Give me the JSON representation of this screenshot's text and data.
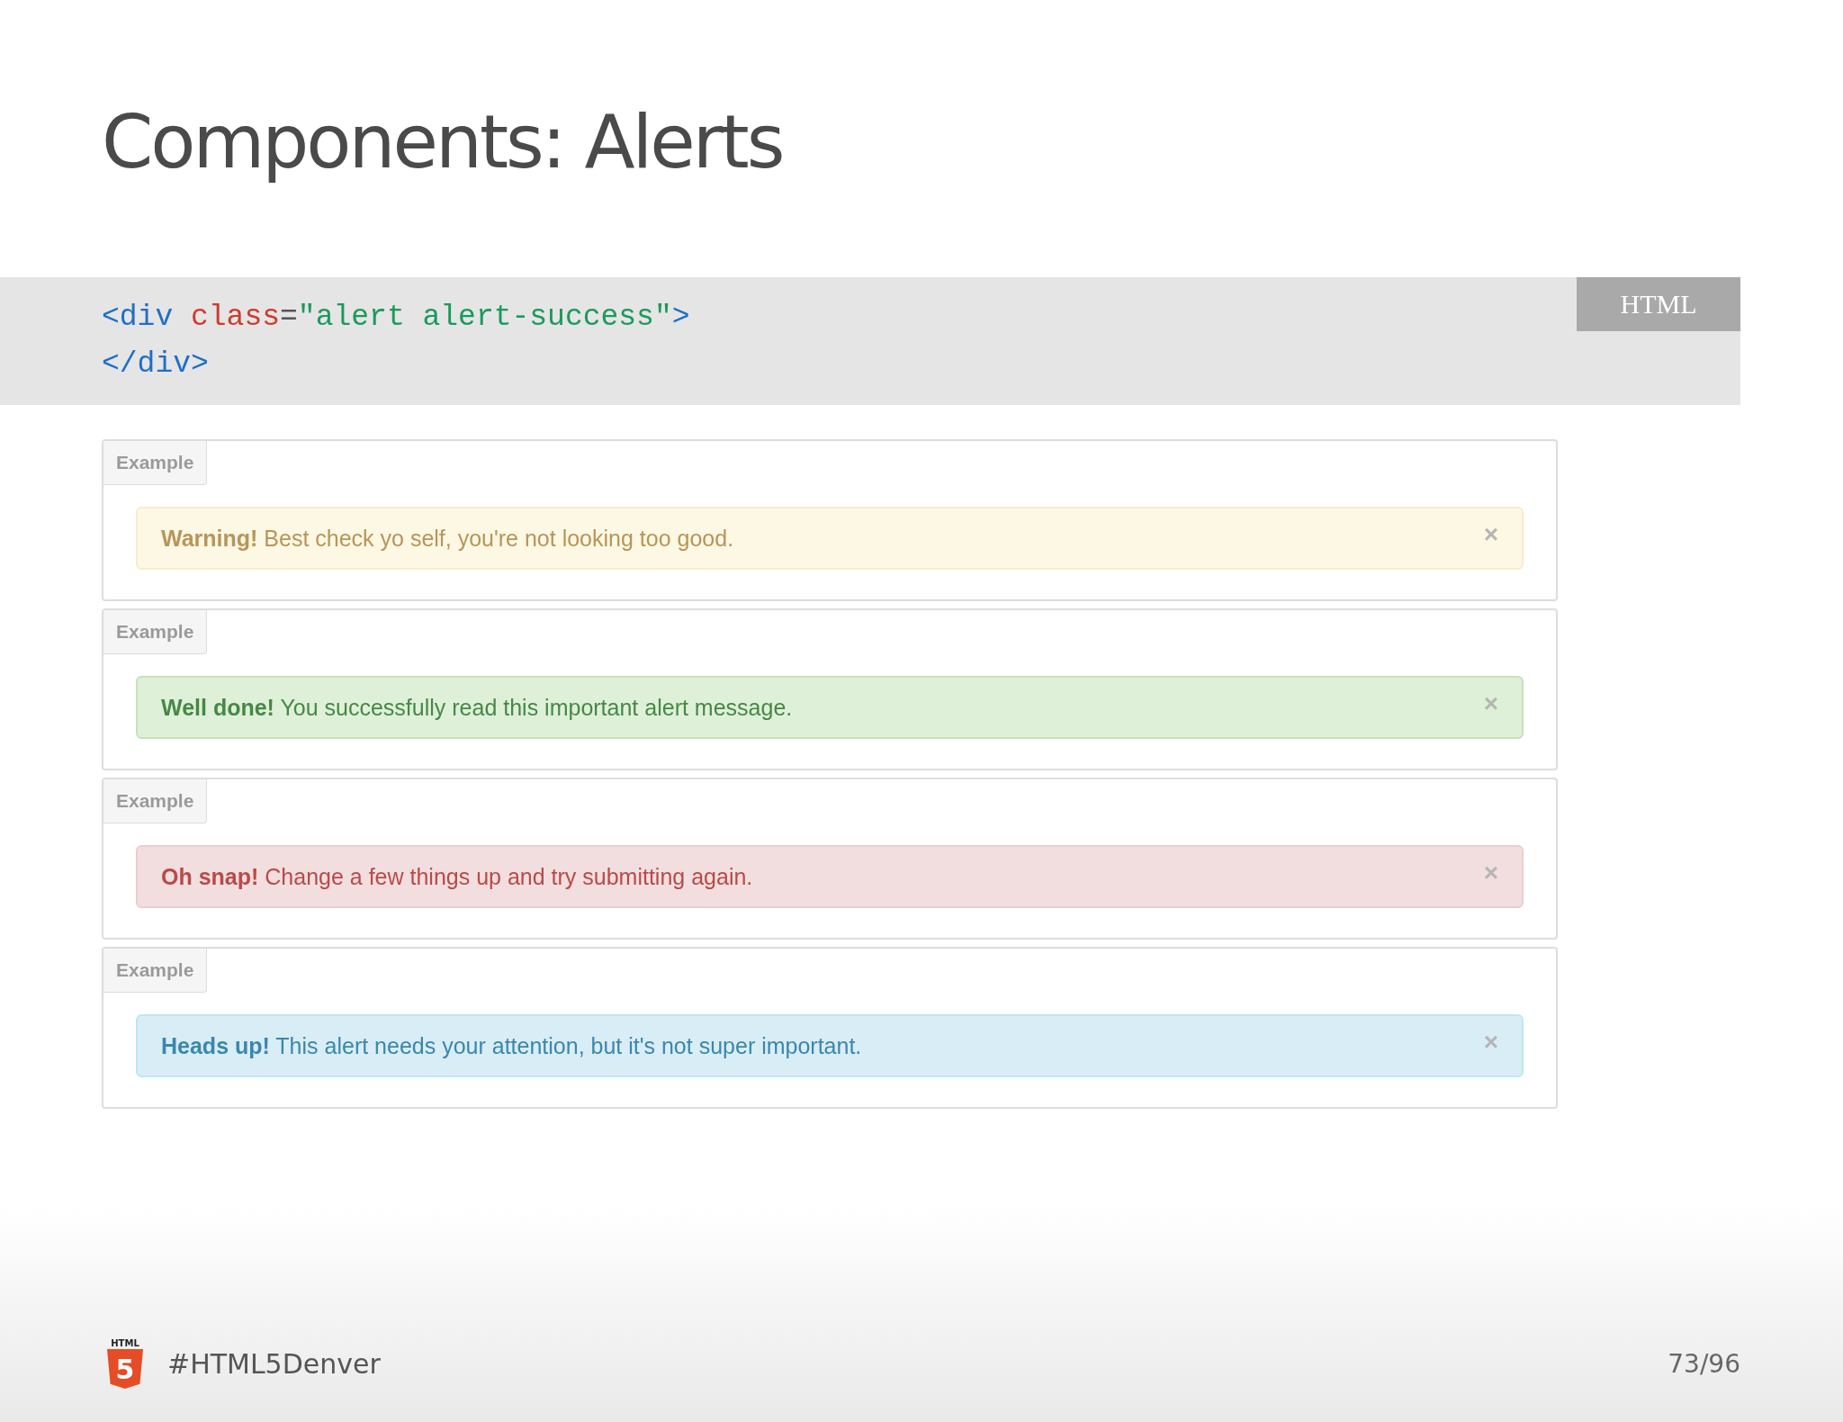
{
  "title": "Components: Alerts",
  "code": {
    "language": "HTML",
    "lines": [
      [
        {
          "kind": "tag",
          "text": "<div"
        },
        {
          "kind": "attr",
          "text": "class",
          "space_before": true
        },
        {
          "kind": "punct",
          "text": "="
        },
        {
          "kind": "string",
          "text": "\"alert alert-success\""
        },
        {
          "kind": "tag",
          "text": ">"
        }
      ],
      [
        {
          "kind": "tag",
          "text": "</div>"
        }
      ]
    ]
  },
  "examples": [
    {
      "label": "Example",
      "alert": {
        "kind": "warning",
        "message": "**Warning!** Best check yo self, you're not looking too good.",
        "close": "×"
      }
    },
    {
      "label": "Example",
      "alert": {
        "kind": "success",
        "message": "**Well done!** You successfully read this important alert message.",
        "close": "×"
      }
    },
    {
      "label": "Example",
      "alert": {
        "kind": "danger",
        "message": "**Oh snap!** Change a few things up and try submitting again.",
        "close": "×"
      }
    },
    {
      "label": "Example",
      "alert": {
        "kind": "info",
        "message": "**Heads up!** This alert needs your attention, but it's not super important.",
        "close": "×"
      }
    }
  ],
  "footer": {
    "logo_label": "HTML",
    "logo_digit": "5",
    "hashtag": "#HTML5Denver",
    "page": "73/96"
  }
}
